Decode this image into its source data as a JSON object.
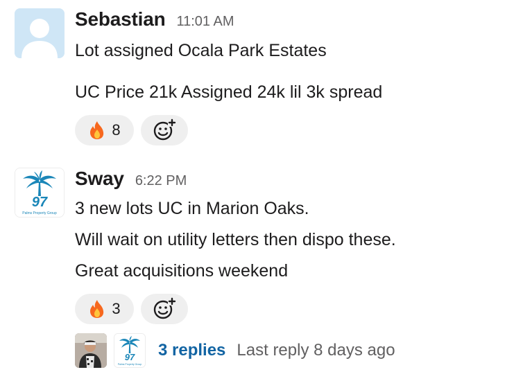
{
  "messages": [
    {
      "username": "Sebastian",
      "timestamp": "11:01 AM",
      "lines": [
        "Lot assigned Ocala Park Estates",
        "UC Price 21k  Assigned 24k  lil 3k spread"
      ],
      "reaction": {
        "emoji": "fire-icon",
        "count": "8"
      }
    },
    {
      "username": "Sway",
      "timestamp": "6:22 PM",
      "avatar_text": {
        "number": "97",
        "caption": "Palms Property Group"
      },
      "lines": [
        "3 new lots UC in Marion Oaks.",
        "Will wait on utility letters then dispo these.",
        "Great acquisitions weekend"
      ],
      "reaction": {
        "emoji": "fire-icon",
        "count": "3"
      }
    }
  ],
  "thread": {
    "replies": "3 replies",
    "last_reply": "Last reply 8 days ago"
  },
  "colors": {
    "link": "#1264a3",
    "muted": "#616061",
    "reaction_bg": "#efefef",
    "brand_teal": "#1a86b8",
    "fire_orange": "#f7681e",
    "fire_yellow": "#ffc63c"
  }
}
